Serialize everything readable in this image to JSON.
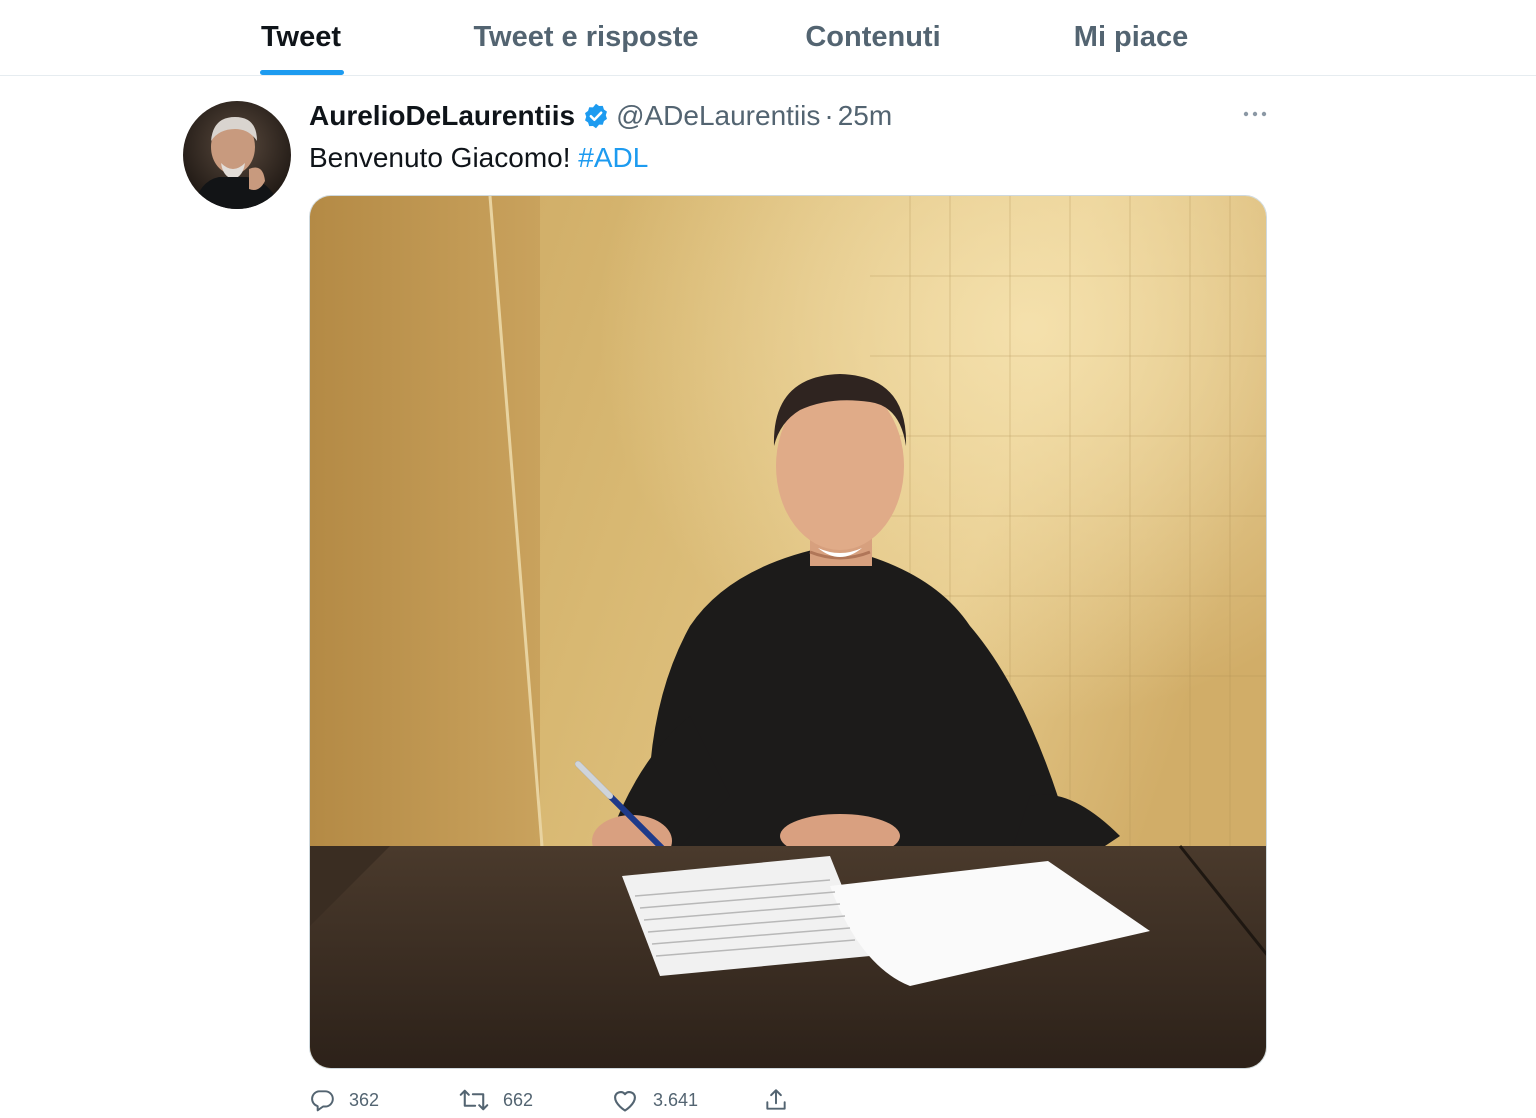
{
  "tabs": [
    {
      "label": "Tweet",
      "active": true
    },
    {
      "label": "Tweet e risposte",
      "active": false
    },
    {
      "label": "Contenuti",
      "active": false
    },
    {
      "label": "Mi piace",
      "active": false
    }
  ],
  "tweet": {
    "display_name": "AurelioDeLaurentiis",
    "verified": true,
    "handle": "@ADeLaurentiis",
    "separator": "·",
    "time": "25m",
    "text": "Benvenuto Giacomo! ",
    "hashtag": "#ADL",
    "media_alt": "Photo of a young man in a black shirt signing a contract at a table",
    "stats": {
      "replies": "362",
      "retweets": "662",
      "likes": "3.641"
    }
  },
  "colors": {
    "accent": "#1d9bf0",
    "text_primary": "#0f1419",
    "text_secondary": "#536471",
    "border": "#e6ecf0"
  },
  "icons": {
    "reply": "reply-icon",
    "retweet": "retweet-icon",
    "like": "heart-icon",
    "share": "share-icon",
    "more": "more-dots-icon",
    "verified": "verified-badge-icon"
  }
}
